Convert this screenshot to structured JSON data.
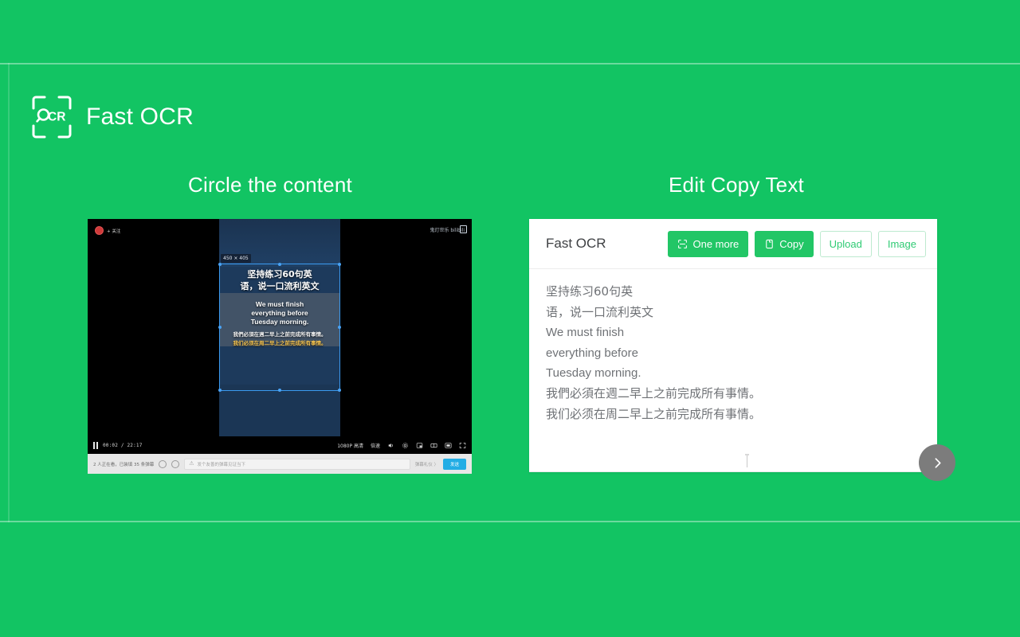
{
  "app": {
    "brand_title": "Fast OCR",
    "logo_icon": "ocr-viewfinder-icon",
    "accent_color": "#12C463",
    "panel_green": "#22C666"
  },
  "sections": {
    "left_heading": "Circle the content",
    "right_heading": "Edit Copy Text"
  },
  "player": {
    "follow_label": "+ 关注",
    "channel_watermark": "鬼灯世乐 bilibili",
    "selection": {
      "size_label": "450 × 405"
    },
    "subtitle": {
      "cn_title_line1": "坚持练习60句英",
      "cn_title_line2": "语，说一口流利英文",
      "en_line1": "We must finish",
      "en_line2": "everything before",
      "en_line3": "Tuesday morning.",
      "cn_trad": "我們必須在週二早上之前完成所有事情。",
      "cn_simp": "我们必须在周二早上之前完成所有事情。"
    },
    "controls": {
      "pause_label": "pause",
      "time": "00:02 / 22:17",
      "quality": "1080P 高清",
      "speed": "倍速",
      "icons": [
        "volume-icon",
        "gear-icon",
        "picture-in-picture-icon",
        "wide-screen-icon",
        "web-fullscreen-icon",
        "fullscreen-icon"
      ]
    },
    "danmaku": {
      "count_text": "2 人正在看，已装填 35 条弹幕",
      "placeholder": "发个友善的弹幕见证当下",
      "etiquette": "弹幕礼仪 〉",
      "send_label": "发送"
    }
  },
  "ocr_panel": {
    "title": "Fast OCR",
    "buttons": [
      {
        "label": "One more",
        "icon": "scan-icon",
        "style": "primary"
      },
      {
        "label": "Copy",
        "icon": "copy-icon",
        "style": "primary"
      },
      {
        "label": "Upload",
        "icon": "",
        "style": "ghost"
      },
      {
        "label": "Image",
        "icon": "",
        "style": "ghost"
      }
    ],
    "result_lines": [
      "坚持练习60句英",
      "语，说一口流利英文",
      "We must finish",
      "everything before",
      "Tuesday morning.",
      "我們必須在週二早上之前完成所有事情。",
      "我们必须在周二早上之前完成所有事情。"
    ]
  },
  "next_button": {
    "icon": "chevron-right-icon"
  }
}
